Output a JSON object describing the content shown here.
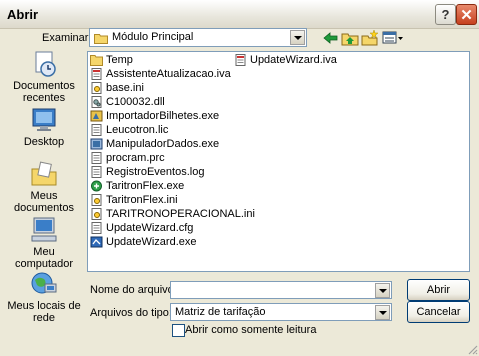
{
  "window": {
    "title": "Abrir",
    "help_glyph": "?",
    "close_glyph": "✕"
  },
  "toolbar": {
    "lookin_label": "Examinar:",
    "lookin_value": "Módulo Principal",
    "icons": [
      "back-arrow-icon",
      "up-folder-icon",
      "new-folder-icon",
      "view-menu-icon"
    ]
  },
  "places": [
    {
      "label": "Documentos recentes",
      "icon": "recent-documents-icon"
    },
    {
      "label": "Desktop",
      "icon": "desktop-icon"
    },
    {
      "label": "Meus documentos",
      "icon": "my-documents-icon"
    },
    {
      "label": "Meu computador",
      "icon": "my-computer-icon"
    },
    {
      "label": "Meus locais de rede",
      "icon": "network-places-icon"
    }
  ],
  "files": {
    "col1": [
      {
        "name": "Temp",
        "type": "folder"
      },
      {
        "name": "AssistenteAtualizacao.iva",
        "type": "iva"
      },
      {
        "name": "base.ini",
        "type": "ini"
      },
      {
        "name": "C100032.dll",
        "type": "dll"
      },
      {
        "name": "ImportadorBilhetes.exe",
        "type": "exe"
      },
      {
        "name": "Leucotron.lic",
        "type": "doc"
      },
      {
        "name": "ManipuladorDados.exe",
        "type": "exe"
      },
      {
        "name": "procram.prc",
        "type": "doc"
      },
      {
        "name": "RegistroEventos.log",
        "type": "doc"
      },
      {
        "name": "TaritronFlex.exe",
        "type": "exe-green"
      },
      {
        "name": "TaritronFlex.ini",
        "type": "ini"
      },
      {
        "name": "TARITRONOPERACIONAL.ini",
        "type": "ini"
      },
      {
        "name": "UpdateWizard.cfg",
        "type": "doc"
      },
      {
        "name": "UpdateWizard.exe",
        "type": "exe-blue"
      }
    ],
    "col2": [
      {
        "name": "UpdateWizard.iva",
        "type": "iva"
      }
    ]
  },
  "filename": {
    "label": "Nome do arquivo:",
    "value": ""
  },
  "filetype": {
    "label": "Arquivos do tipo:",
    "value": "Matriz de tarifação"
  },
  "buttons": {
    "open": "Abrir",
    "cancel": "Cancelar"
  },
  "readonly_label": "Abrir como somente leitura",
  "colors": {
    "dialog_bg": "#ece9d8",
    "folder": "#f5d66a",
    "field_border": "#7f9db9",
    "close": "#c6401f"
  }
}
